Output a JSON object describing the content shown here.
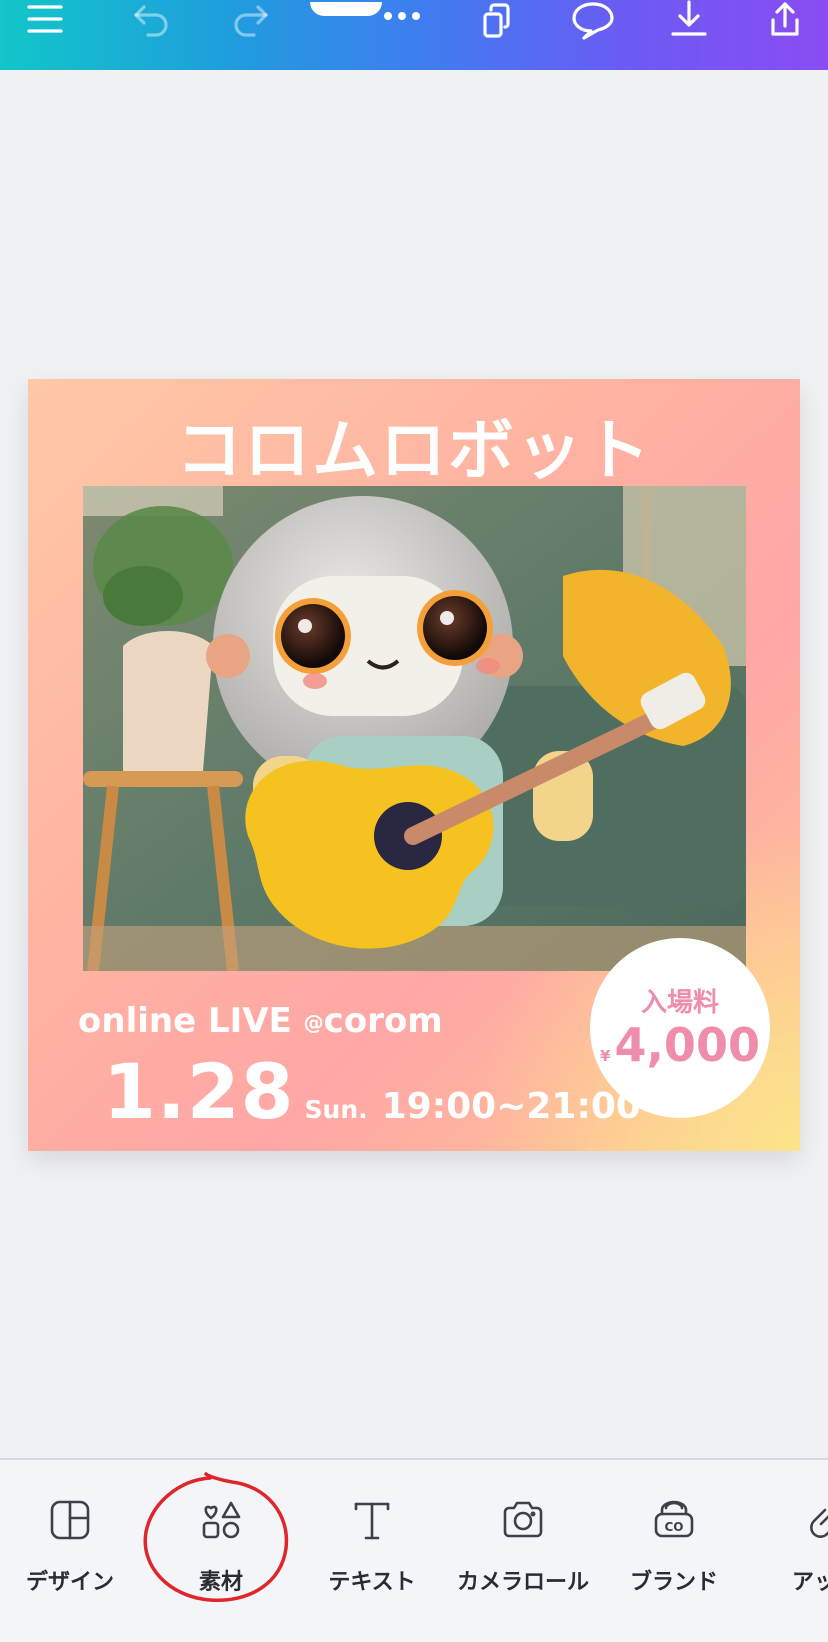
{
  "toolbar": {
    "menu_icon": "hamburger-menu-icon",
    "undo_icon": "undo-icon",
    "redo_icon": "redo-icon",
    "more_icon": "more-dots-icon",
    "pages_icon": "pages-icon",
    "comment_icon": "comment-icon",
    "download_icon": "download-icon",
    "share_icon": "share-icon"
  },
  "design": {
    "title": "コロムロボット",
    "online_prefix": "online LIVE",
    "online_at": "@",
    "online_suffix": "corom",
    "date": "1.28",
    "day": "Sun.",
    "time": "19:00~21:00",
    "price_label": "入場料",
    "price_currency": "¥",
    "price_value": "4,000"
  },
  "bottom_tools": [
    {
      "label": "デザイン",
      "icon": "layout-icon"
    },
    {
      "label": "素材",
      "icon": "elements-icon"
    },
    {
      "label": "テキスト",
      "icon": "text-icon"
    },
    {
      "label": "カメラロール",
      "icon": "camera-icon"
    },
    {
      "label": "ブランド",
      "icon": "brand-icon"
    },
    {
      "label": "アップ",
      "icon": "upload-icon"
    }
  ],
  "colors": {
    "topbar_start": "#12c6c9",
    "topbar_end": "#8b4cf2",
    "annotation": "#e0262b",
    "price_pink": "#ef8eaa"
  }
}
